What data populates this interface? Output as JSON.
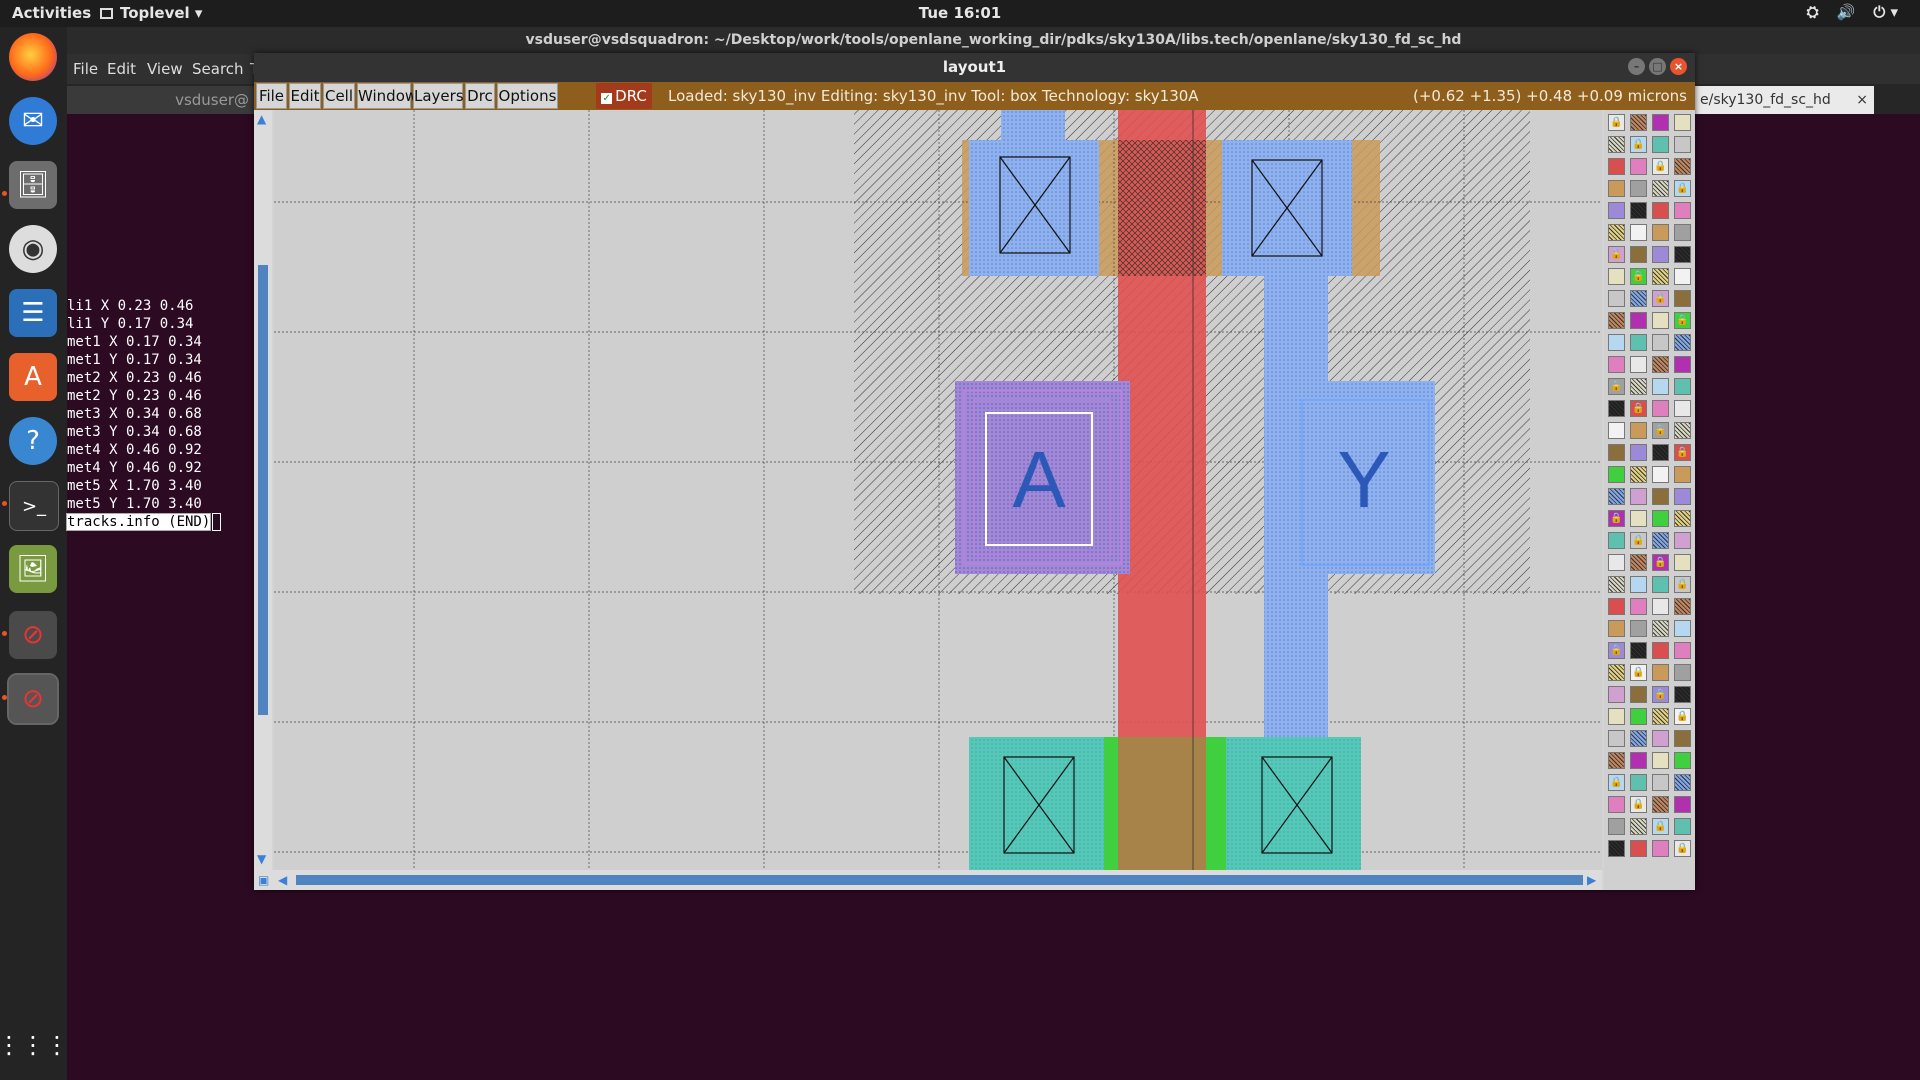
{
  "top_bar": {
    "activities": "Activities",
    "app_menu": "Toplevel ▾",
    "clock": "Tue 16:01",
    "tray": [
      "⛭",
      "🔊",
      "⏻ ▾"
    ]
  },
  "dock": {
    "icons": [
      "firefox-icon",
      "thunderbird-icon",
      "files-icon",
      "rhythmbox-icon",
      "writer-icon",
      "software-icon",
      "help-icon",
      "terminal-icon",
      "image-viewer-icon",
      "blocked-app-icon",
      "blocked-app-icon",
      "show-apps-icon"
    ]
  },
  "terminal": {
    "title": "vsduser@vsdsquadron: ~/Desktop/work/tools/openlane_working_dir/pdks/sky130A/libs.tech/openlane/sky130_fd_sc_hd",
    "menu": [
      "File",
      "Edit",
      "View",
      "Search",
      "T"
    ],
    "tab_left": "vsduser@",
    "tab_right": "e/sky130_fd_sc_hd",
    "tab_close": "×",
    "lines": [
      "li1 X 0.23 0.46",
      "li1 Y 0.17 0.34",
      "met1 X 0.17 0.34",
      "met1 Y 0.17 0.34",
      "met2 X 0.23 0.46",
      "met2 Y 0.23 0.46",
      "met3 X 0.34 0.68",
      "met3 Y 0.34 0.68",
      "met4 X 0.46 0.92",
      "met4 Y 0.46 0.92",
      "met5 X 1.70 3.40",
      "met5 Y 1.70 3.40"
    ],
    "last_line": "tracks.info (END)"
  },
  "magic": {
    "title": "layout1",
    "menu": [
      "File",
      "Edit",
      "Cell",
      "Window",
      "Layers",
      "Drc",
      "Options"
    ],
    "drc_label": "DRC",
    "status": "Loaded: sky130_inv Editing: sky130_inv Tool: box  Technology: sky130A",
    "coords": "(+0.62 +1.35) +0.48 +0.09 microns",
    "labels": {
      "input": "A",
      "output": "Y"
    },
    "colors": {
      "poly": "#e05050",
      "metal1": "#7fa7e8",
      "locali": "#9c8ad8",
      "ndiff": "#3fcf3f",
      "pdiff": "#c99a5a",
      "nwell": "#000000"
    }
  }
}
